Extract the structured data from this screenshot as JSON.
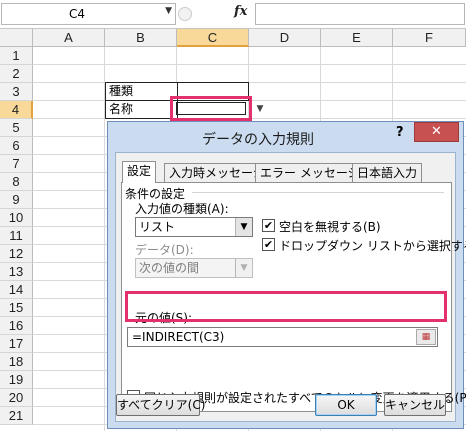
{
  "formula_bar": {
    "name_box": "C4",
    "fx_label": "fx",
    "formula": ""
  },
  "sheet": {
    "columns": [
      "A",
      "B",
      "C",
      "D",
      "E",
      "F"
    ],
    "selected_column": "C",
    "rows": [
      "1",
      "2",
      "3",
      "4",
      "5",
      "6",
      "7",
      "8",
      "9",
      "10",
      "11",
      "12",
      "13",
      "14",
      "15",
      "16",
      "17",
      "18",
      "19",
      "20",
      "21"
    ],
    "selected_row": "4",
    "cells": {
      "B3": "種類",
      "B4": "名称"
    }
  },
  "dialog": {
    "title": "データの入力規則",
    "help_label": "?",
    "close_label": "✕",
    "tabs": [
      "設定",
      "入力時メッセージ",
      "エラー メッセージ",
      "日本語入力"
    ],
    "active_tab": "設定",
    "section_title": "条件の設定",
    "allow_label": "入力値の種類(A):",
    "allow_value": "リスト",
    "data_label": "データ(D):",
    "data_value": "次の値の間",
    "ignore_blank": {
      "label": "空白を無視する(B)",
      "checked": true
    },
    "in_cell_dropdown": {
      "label": "ドロップダウン リストから選択する(I)",
      "checked": true
    },
    "source_label": "元の値(S):",
    "source_value": "=INDIRECT(C3)",
    "apply_all": {
      "label": "同じ入力規則が設定されたすべてのセルに変更を適用する(P)",
      "checked": false
    },
    "clear_all_label": "すべてクリア(C)",
    "ok_label": "OK",
    "cancel_label": "キャンセル"
  },
  "colors": {
    "highlight": "#e3316e",
    "dialog_frame": "#cbdcf0",
    "close_button": "#c75050",
    "selected_header": "#f9d99a"
  },
  "icons": {
    "name_box_arrow": "chevron-down-icon",
    "fx": "function-icon",
    "ref_button": "range-select-icon",
    "close": "close-icon",
    "help": "help-icon",
    "dropdown": "dropdown-arrow-icon",
    "check": "checkmark-icon"
  }
}
